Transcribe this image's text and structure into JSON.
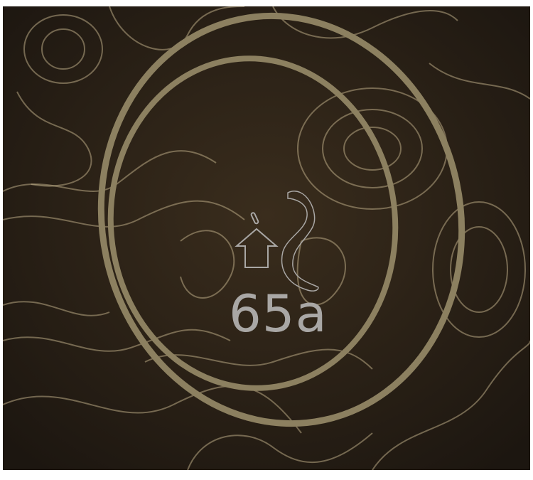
{
  "overlay": {
    "label": "65a",
    "icons": [
      "up-arrow-icon",
      "o-ring-cross-section-icon"
    ],
    "text_color": "#a9a7a5"
  },
  "photo": {
    "background_color": "#2a2017",
    "ring_color": "#8c8060",
    "contour_color": "#b8a884"
  }
}
